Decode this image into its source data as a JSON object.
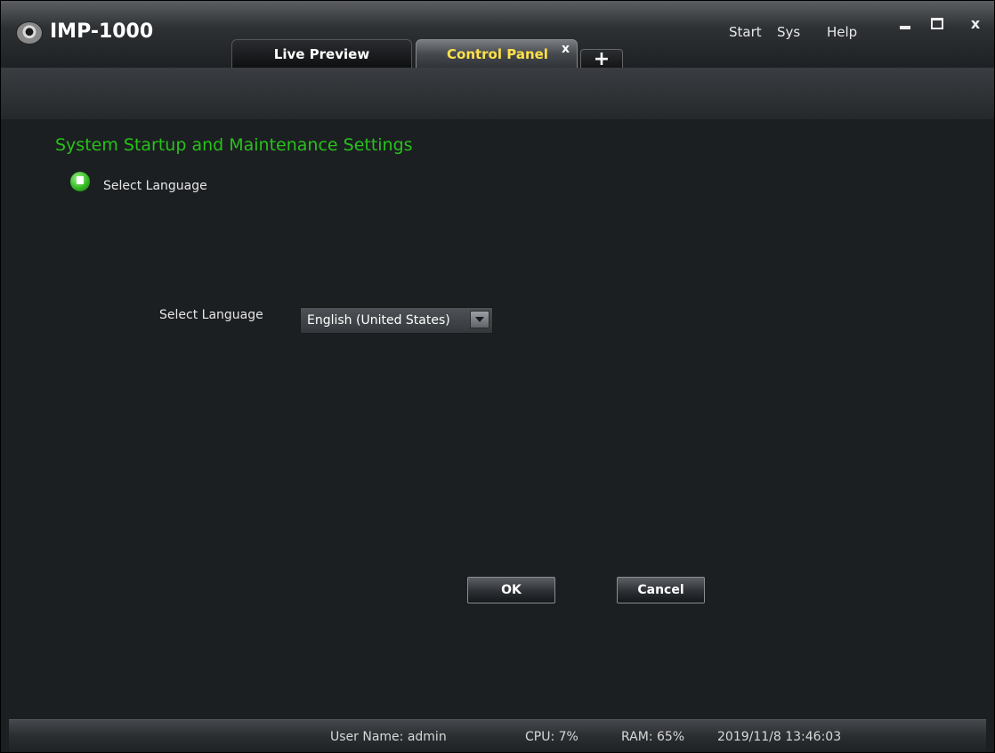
{
  "app": {
    "title": "IMP-1000",
    "icon": "webcam-logo-icon"
  },
  "tabs": [
    {
      "label": "Live Preview",
      "active": false
    },
    {
      "label": "Control Panel",
      "active": true,
      "close_label": "x"
    }
  ],
  "add_tab_label": "+",
  "menu": {
    "start": "Start",
    "sys": "Sys",
    "help": "Help"
  },
  "window_controls": {
    "close_label": "x"
  },
  "section": {
    "title": "System Startup and Maintenance Settings",
    "subtitle": "Select Language"
  },
  "form": {
    "language_label": "Select Language",
    "language_value": "English (United States)"
  },
  "buttons": {
    "ok": "OK",
    "cancel": "Cancel"
  },
  "status": {
    "user": "User Name: admin",
    "cpu": "CPU: 7%",
    "ram": "RAM: 65%",
    "time": "2019/11/8 13:46:03"
  },
  "colors": {
    "accent_green": "#27c21a",
    "active_tab_text": "#ffe14a",
    "background": "#1c1f22"
  }
}
